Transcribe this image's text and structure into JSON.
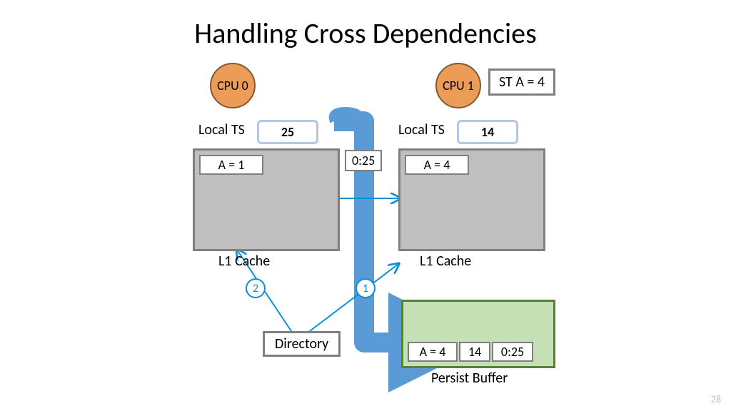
{
  "title": "Handling Cross Dependencies",
  "page_number": "28",
  "cpu0": {
    "label": "CPU 0",
    "local_ts_label": "Local TS",
    "local_ts_value": "25",
    "cache_label": "L1 Cache",
    "cache_entry": "A = 1"
  },
  "cpu1": {
    "label": "CPU 1",
    "instruction": "ST A = 4",
    "local_ts_label": "Local TS",
    "local_ts_value": "14",
    "cache_label": "L1 Cache",
    "cache_entry": "A = 4"
  },
  "message": "0:25",
  "directory_label": "Directory",
  "persist_buffer": {
    "label": "Persist Buffer",
    "entry_value": "A = 4",
    "entry_ts": "14",
    "entry_dep": "0:25"
  },
  "steps": {
    "s1": "1",
    "s2": "2"
  }
}
